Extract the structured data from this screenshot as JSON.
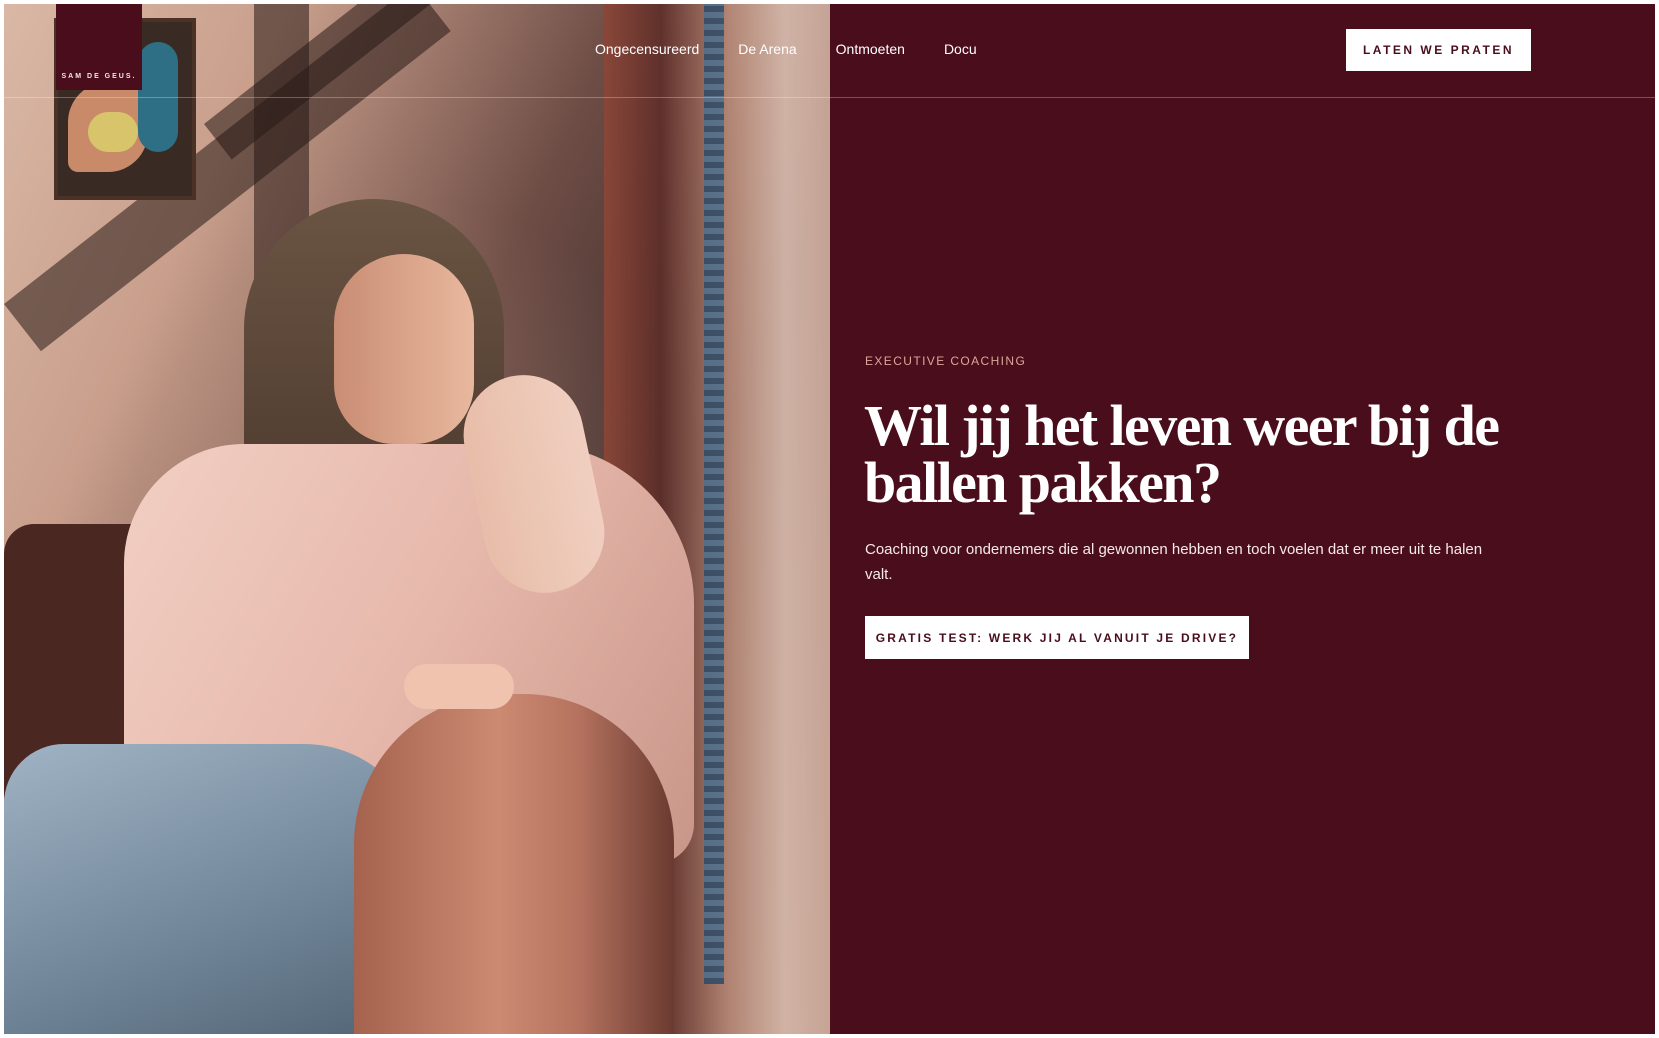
{
  "brand": {
    "logo_text": "SAM DE GEUS.",
    "primary_color": "#4a0d1c",
    "accent_text_color": "#d9a99a"
  },
  "nav": {
    "items": [
      {
        "label": "Ongecensureerd"
      },
      {
        "label": "De Arena"
      },
      {
        "label": "Ontmoeten"
      },
      {
        "label": "Docu"
      }
    ],
    "cta_label": "LATEN WE PRATEN"
  },
  "hero": {
    "eyebrow": "EXECUTIVE COACHING",
    "headline": "Wil jij het leven weer bij de ballen pakken?",
    "subtext": "Coaching voor ondernemers die al gewonnen hebben en toch voelen dat er meer uit te halen valt.",
    "cta_label": "GRATIS TEST: WERK JIJ AL VANUIT JE DRIVE?"
  }
}
